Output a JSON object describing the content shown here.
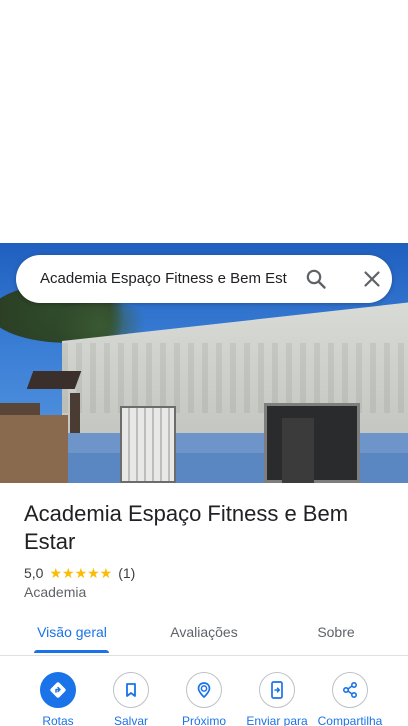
{
  "search": {
    "query": "Academia Espaço Fitness e Bem Est",
    "search_icon": "search-icon",
    "close_icon": "close-icon"
  },
  "place": {
    "title": "Academia Espaço Fitness e Bem Estar",
    "rating": "5,0",
    "stars": "★★★★★",
    "stars_value": 5,
    "review_count": "(1)",
    "category": "Academia"
  },
  "tabs": [
    {
      "label": "Visão geral",
      "active": true
    },
    {
      "label": "Avaliações",
      "active": false
    },
    {
      "label": "Sobre",
      "active": false
    }
  ],
  "actions": [
    {
      "label": "Rotas",
      "icon": "directions-icon"
    },
    {
      "label": "Salvar",
      "icon": "bookmark-icon"
    },
    {
      "label": "Próximo",
      "icon": "nearby-icon"
    },
    {
      "label": "Enviar para",
      "icon": "send-to-phone-icon"
    },
    {
      "label": "Compartilha",
      "icon": "share-icon"
    }
  ],
  "colors": {
    "accent": "#1a73e8",
    "star": "#fbbc04",
    "text": "#202124",
    "secondary_text": "#5f6368"
  }
}
